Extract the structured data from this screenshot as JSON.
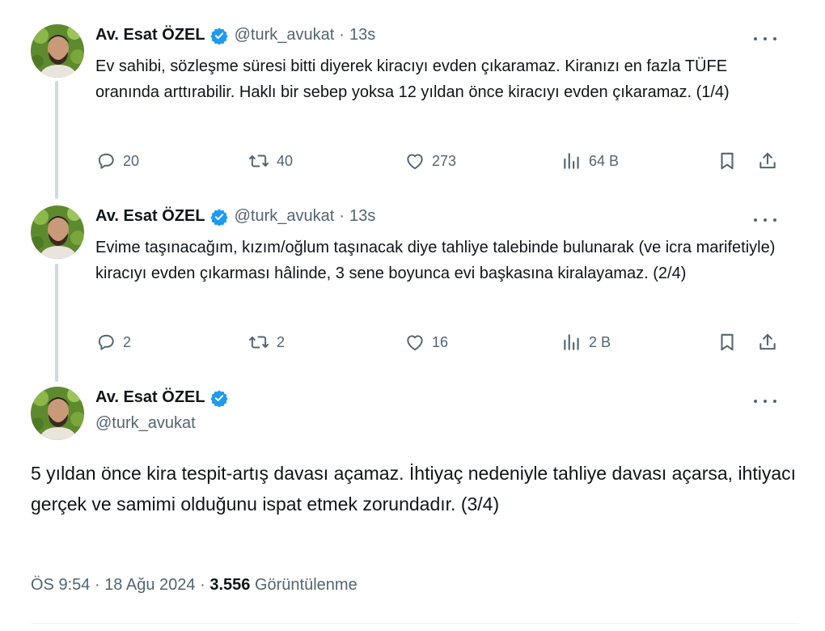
{
  "author": {
    "name": "Av. Esat ÖZEL",
    "handle": "@turk_avukat",
    "verified_color": "#1d9bf0"
  },
  "tweets": [
    {
      "time": "13s",
      "text": "Ev sahibi, sözleşme süresi bitti diyerek kiracıyı evden çıkaramaz. Kiranızı en fazla TÜFE oranında arttırabilir. Haklı bir sebep yoksa 12 yıldan önce kiracıyı evden çıkaramaz. (1/4)",
      "replies": "20",
      "reposts": "40",
      "likes": "273",
      "views": "64 B"
    },
    {
      "time": "13s",
      "text": "Evime taşınacağım, kızım/oğlum taşınacak diye tahliye talebinde bulunarak (ve icra marifetiyle) kiracıyı evden çıkarması hâlinde, 3 sene boyunca evi başkasına kiralayamaz. (2/4)",
      "replies": "2",
      "reposts": "2",
      "likes": "16",
      "views": "2 B"
    }
  ],
  "main_tweet": {
    "text": "5 yıldan önce kira tespit-artış davası açamaz. İhtiyaç nedeniyle tahliye davası açarsa, ihtiyacı gerçek ve samimi olduğunu ispat etmek zorundadır. (3/4)",
    "time": "ÖS 9:54",
    "date": "18 Ağu 2024",
    "views_count": "3.556",
    "views_label": "Görüntülenme"
  },
  "separator": "·",
  "icons": {
    "reply": "reply-icon",
    "repost": "repost-icon",
    "like": "heart-icon",
    "views": "views-icon",
    "bookmark": "bookmark-icon",
    "share": "share-icon",
    "more": "more-icon",
    "verified": "verified-badge-icon"
  },
  "colors": {
    "text": "#0f1419",
    "secondary": "#536471",
    "thread_line": "#cfd9de",
    "verified": "#1d9bf0"
  }
}
